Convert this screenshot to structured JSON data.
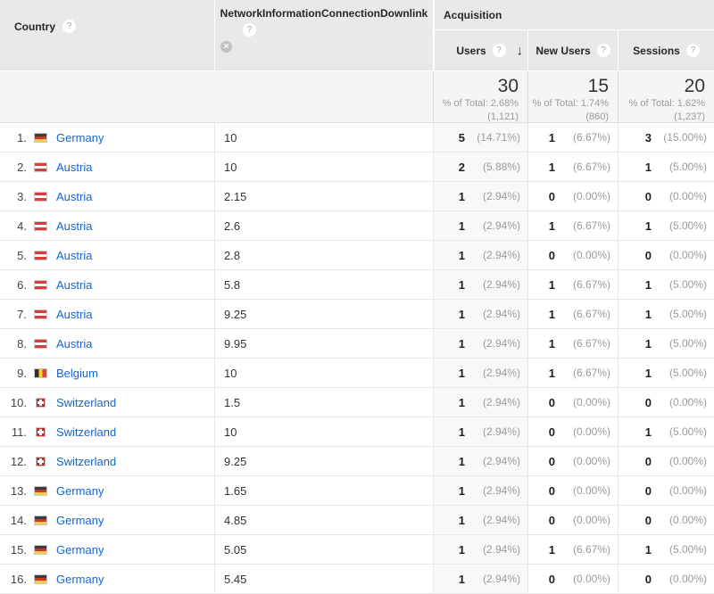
{
  "header": {
    "country_label": "Country",
    "network_label": "NetworkInformationConnectionDownlink",
    "acquisition_label": "Acquisition",
    "users_label": "Users",
    "new_users_label": "New Users",
    "sessions_label": "Sessions",
    "help_icon": "?",
    "close_icon": "×",
    "sort_arrow": "↓"
  },
  "summary": {
    "users": {
      "value": "30",
      "pct_of_total": "% of Total: 2.68%",
      "total": "(1,121)"
    },
    "new_users": {
      "value": "15",
      "pct_of_total": "% of Total: 1.74%",
      "total": "(860)"
    },
    "sessions": {
      "value": "20",
      "pct_of_total": "% of Total: 1.62%",
      "total": "(1,237)"
    }
  },
  "rows": [
    {
      "index": "1.",
      "flag": "de",
      "country": "Germany",
      "network": "10",
      "users": "5",
      "users_pct": "(14.71%)",
      "new_users": "1",
      "new_users_pct": "(6.67%)",
      "sessions": "3",
      "sessions_pct": "(15.00%)"
    },
    {
      "index": "2.",
      "flag": "at",
      "country": "Austria",
      "network": "10",
      "users": "2",
      "users_pct": "(5.88%)",
      "new_users": "1",
      "new_users_pct": "(6.67%)",
      "sessions": "1",
      "sessions_pct": "(5.00%)"
    },
    {
      "index": "3.",
      "flag": "at",
      "country": "Austria",
      "network": "2.15",
      "users": "1",
      "users_pct": "(2.94%)",
      "new_users": "0",
      "new_users_pct": "(0.00%)",
      "sessions": "0",
      "sessions_pct": "(0.00%)"
    },
    {
      "index": "4.",
      "flag": "at",
      "country": "Austria",
      "network": "2.6",
      "users": "1",
      "users_pct": "(2.94%)",
      "new_users": "1",
      "new_users_pct": "(6.67%)",
      "sessions": "1",
      "sessions_pct": "(5.00%)"
    },
    {
      "index": "5.",
      "flag": "at",
      "country": "Austria",
      "network": "2.8",
      "users": "1",
      "users_pct": "(2.94%)",
      "new_users": "0",
      "new_users_pct": "(0.00%)",
      "sessions": "0",
      "sessions_pct": "(0.00%)"
    },
    {
      "index": "6.",
      "flag": "at",
      "country": "Austria",
      "network": "5.8",
      "users": "1",
      "users_pct": "(2.94%)",
      "new_users": "1",
      "new_users_pct": "(6.67%)",
      "sessions": "1",
      "sessions_pct": "(5.00%)"
    },
    {
      "index": "7.",
      "flag": "at",
      "country": "Austria",
      "network": "9.25",
      "users": "1",
      "users_pct": "(2.94%)",
      "new_users": "1",
      "new_users_pct": "(6.67%)",
      "sessions": "1",
      "sessions_pct": "(5.00%)"
    },
    {
      "index": "8.",
      "flag": "at",
      "country": "Austria",
      "network": "9.95",
      "users": "1",
      "users_pct": "(2.94%)",
      "new_users": "1",
      "new_users_pct": "(6.67%)",
      "sessions": "1",
      "sessions_pct": "(5.00%)"
    },
    {
      "index": "9.",
      "flag": "be",
      "country": "Belgium",
      "network": "10",
      "users": "1",
      "users_pct": "(2.94%)",
      "new_users": "1",
      "new_users_pct": "(6.67%)",
      "sessions": "1",
      "sessions_pct": "(5.00%)"
    },
    {
      "index": "10.",
      "flag": "ch",
      "country": "Switzerland",
      "network": "1.5",
      "users": "1",
      "users_pct": "(2.94%)",
      "new_users": "0",
      "new_users_pct": "(0.00%)",
      "sessions": "0",
      "sessions_pct": "(0.00%)"
    },
    {
      "index": "11.",
      "flag": "ch",
      "country": "Switzerland",
      "network": "10",
      "users": "1",
      "users_pct": "(2.94%)",
      "new_users": "0",
      "new_users_pct": "(0.00%)",
      "sessions": "1",
      "sessions_pct": "(5.00%)"
    },
    {
      "index": "12.",
      "flag": "ch",
      "country": "Switzerland",
      "network": "9.25",
      "users": "1",
      "users_pct": "(2.94%)",
      "new_users": "0",
      "new_users_pct": "(0.00%)",
      "sessions": "0",
      "sessions_pct": "(0.00%)"
    },
    {
      "index": "13.",
      "flag": "de",
      "country": "Germany",
      "network": "1.65",
      "users": "1",
      "users_pct": "(2.94%)",
      "new_users": "0",
      "new_users_pct": "(0.00%)",
      "sessions": "0",
      "sessions_pct": "(0.00%)"
    },
    {
      "index": "14.",
      "flag": "de",
      "country": "Germany",
      "network": "4.85",
      "users": "1",
      "users_pct": "(2.94%)",
      "new_users": "0",
      "new_users_pct": "(0.00%)",
      "sessions": "0",
      "sessions_pct": "(0.00%)"
    },
    {
      "index": "15.",
      "flag": "de",
      "country": "Germany",
      "network": "5.05",
      "users": "1",
      "users_pct": "(2.94%)",
      "new_users": "1",
      "new_users_pct": "(6.67%)",
      "sessions": "1",
      "sessions_pct": "(5.00%)"
    },
    {
      "index": "16.",
      "flag": "de",
      "country": "Germany",
      "network": "5.45",
      "users": "1",
      "users_pct": "(2.94%)",
      "new_users": "0",
      "new_users_pct": "(0.00%)",
      "sessions": "0",
      "sessions_pct": "(0.00%)"
    }
  ],
  "colors": {
    "link_blue": "#1765cc",
    "header_bg": "#e9e9e9",
    "summary_bg": "#f5f5f5",
    "sorted_column_bg": "#f8f8f8",
    "percent_gray": "#9b9b9b",
    "text_dark": "#333333"
  }
}
